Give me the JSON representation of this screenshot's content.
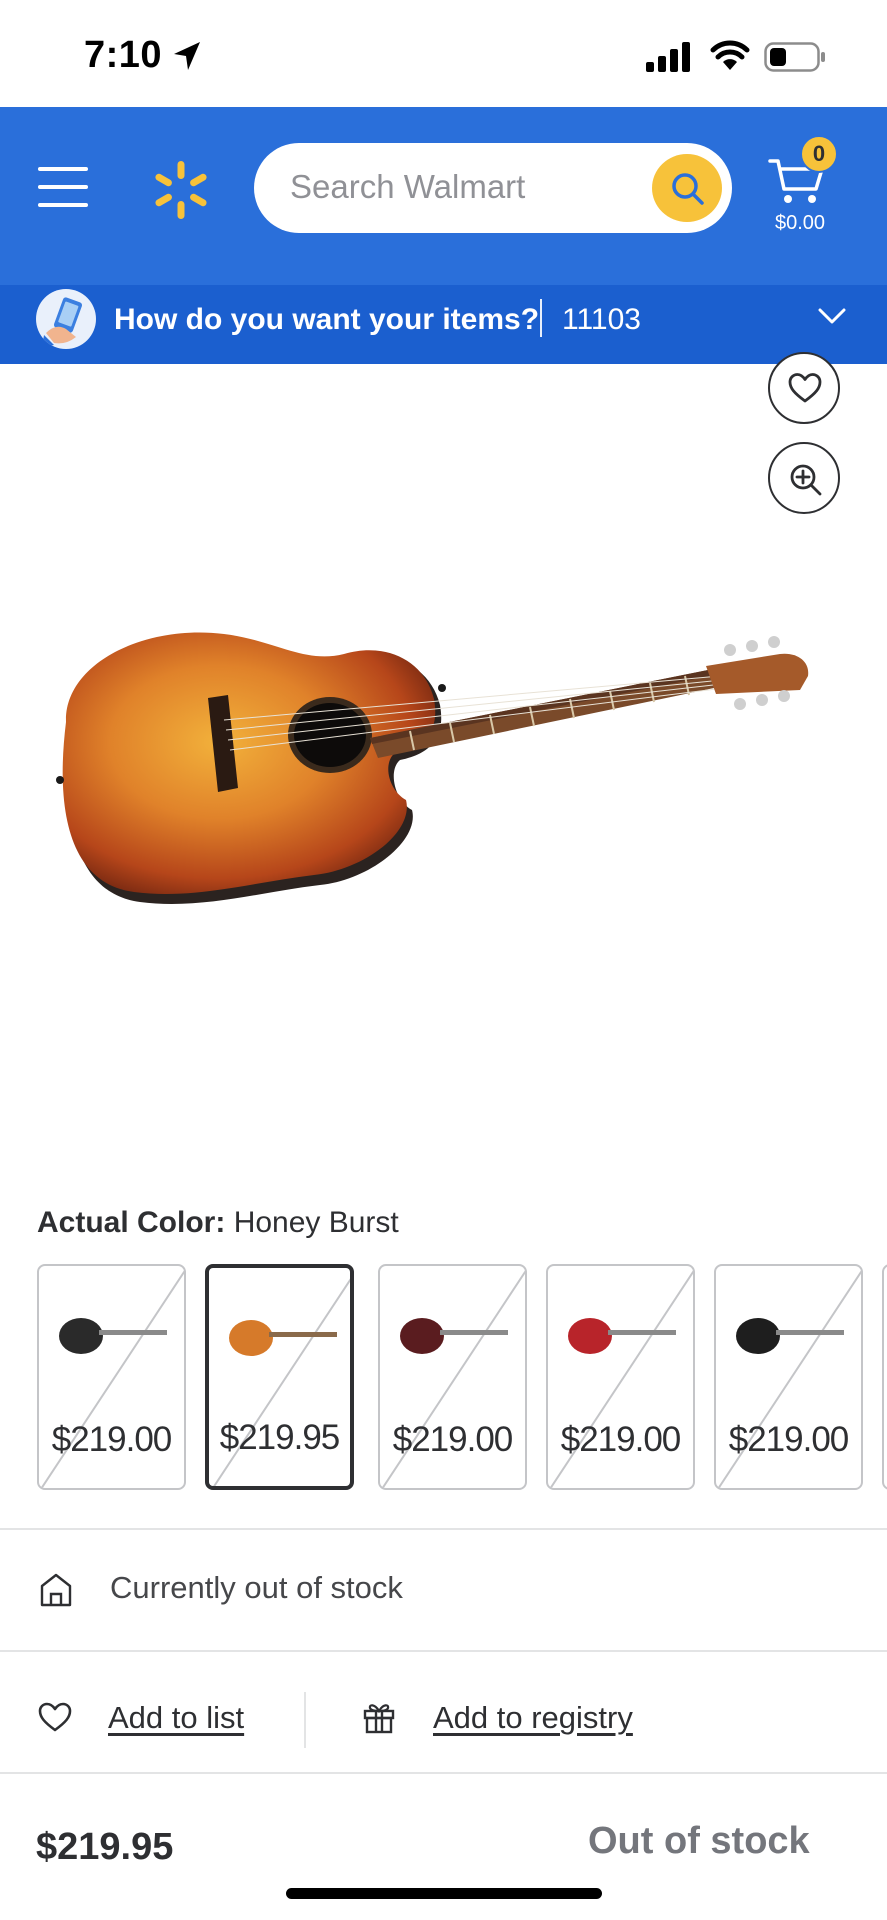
{
  "status_bar": {
    "time": "7:10"
  },
  "header": {
    "search_placeholder": "Search Walmart",
    "cart_count": "0",
    "cart_total": "$0.00",
    "brand_color": "#2a6fda",
    "accent_color": "#f7c23a"
  },
  "fulfillment": {
    "question": "How do you want your items?",
    "zip": "11103"
  },
  "product": {
    "image_icons": [
      "heart-icon",
      "zoom-icon"
    ],
    "color_label": "Actual Color:",
    "color_value": "Honey Burst",
    "swatches": [
      {
        "price": "$219.00",
        "color": "#2a2a2a",
        "selected": false
      },
      {
        "price": "$219.95",
        "color": "#d67a2a",
        "selected": true
      },
      {
        "price": "$219.00",
        "color": "#5a1c1f",
        "selected": false
      },
      {
        "price": "$219.00",
        "color": "#b8242a",
        "selected": false
      },
      {
        "price": "$219.00",
        "color": "#1e1e1e",
        "selected": false
      }
    ],
    "stock_status": "Currently out of stock",
    "add_to_list": "Add to list",
    "add_to_registry": "Add to registry",
    "price": "$219.95",
    "availability": "Out of stock"
  }
}
